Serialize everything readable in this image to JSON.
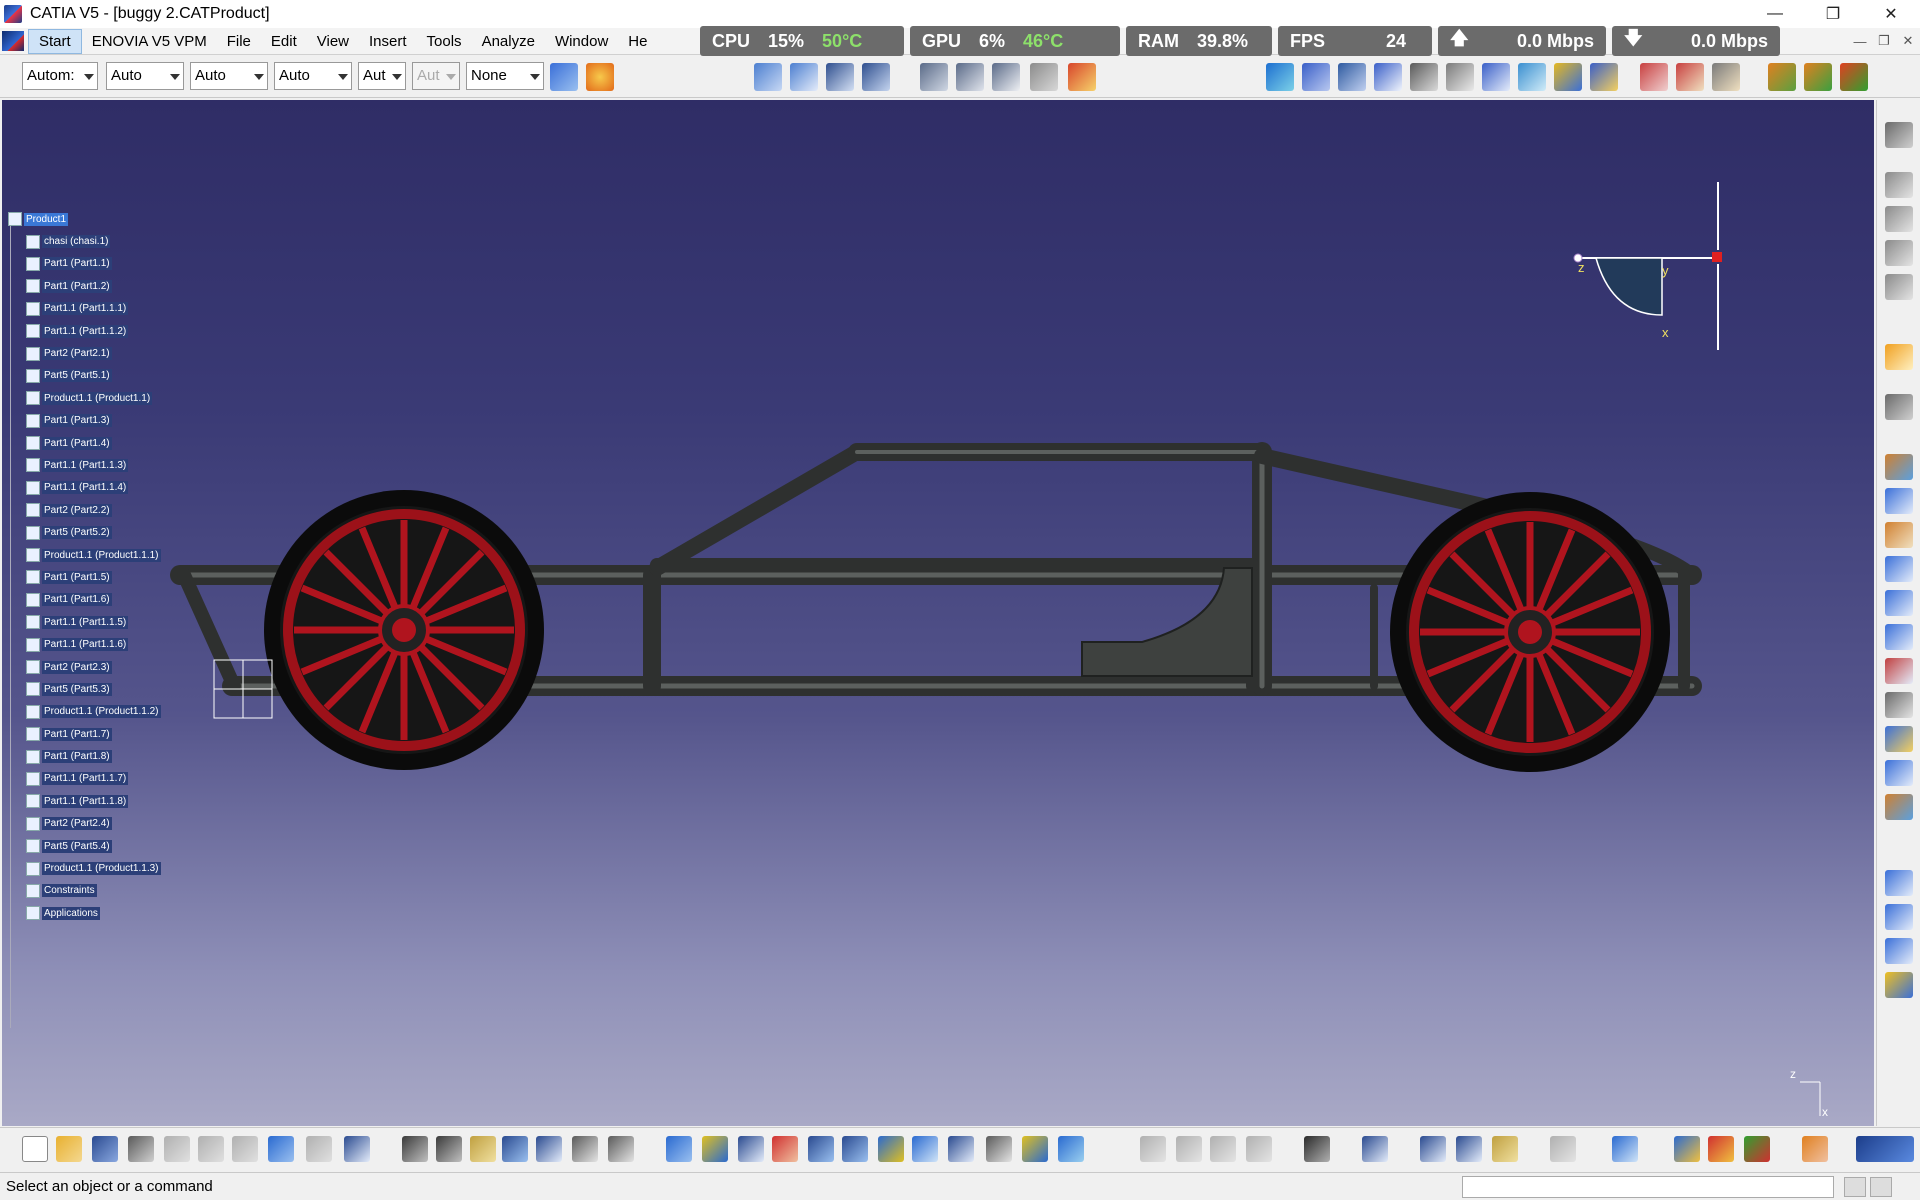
{
  "window": {
    "title": "CATIA V5 - [buggy 2.CATProduct]",
    "controls": [
      "—",
      "❐",
      "✕"
    ]
  },
  "menu": {
    "items": [
      "Start",
      "ENOVIA V5 VPM",
      "File",
      "Edit",
      "View",
      "Insert",
      "Tools",
      "Analyze",
      "Window",
      "He"
    ],
    "active": "Start"
  },
  "perf": {
    "cpu": {
      "label": "CPU",
      "load": "15%",
      "temp": "50°C"
    },
    "gpu": {
      "label": "GPU",
      "load": "6%",
      "temp": "46°C"
    },
    "ram": {
      "label": "RAM",
      "value": "39.8%"
    },
    "fps": {
      "label": "FPS",
      "value": "24"
    },
    "up": {
      "arrow": "🡅",
      "value": "0.0 Mbps"
    },
    "down": {
      "arrow": "🡇",
      "value": "0.0 Mbps"
    }
  },
  "toolbar2": {
    "combos": [
      "Autom:",
      "Auto",
      "Auto",
      "Auto",
      "Aut",
      "Aut",
      "None"
    ]
  },
  "tree": {
    "root": "Product1",
    "items": [
      "chasi (chasi.1)",
      "Part1 (Part1.1)",
      "Part1 (Part1.2)",
      "Part1.1 (Part1.1.1)",
      "Part1.1 (Part1.1.2)",
      "Part2 (Part2.1)",
      "Part5 (Part5.1)",
      "Product1.1 (Product1.1)",
      "Part1 (Part1.3)",
      "Part1 (Part1.4)",
      "Part1.1 (Part1.1.3)",
      "Part1.1 (Part1.1.4)",
      "Part2 (Part2.2)",
      "Part5 (Part5.2)",
      "Product1.1 (Product1.1.1)",
      "Part1 (Part1.5)",
      "Part1 (Part1.6)",
      "Part1.1 (Part1.1.5)",
      "Part1.1 (Part1.1.6)",
      "Part2 (Part2.3)",
      "Part5 (Part5.3)",
      "Product1.1 (Product1.1.2)",
      "Part1 (Part1.7)",
      "Part1 (Part1.8)",
      "Part1.1 (Part1.1.7)",
      "Part1.1 (Part1.1.8)",
      "Part2 (Part2.4)",
      "Part5 (Part5.4)",
      "Product1.1 (Product1.1.3)",
      "Constraints",
      "Applications"
    ]
  },
  "compass": {
    "z": "z",
    "y": "y",
    "x": "x"
  },
  "axis_small": {
    "z": "z",
    "x": "x"
  },
  "status": {
    "text": "Select an object or a command"
  },
  "colors": {
    "viewport_top": "#2f2d66",
    "viewport_bottom": "#a9a9c6",
    "rim": "#b0141e",
    "tube": "#3a3d3b",
    "spring": "#d8c21a"
  }
}
